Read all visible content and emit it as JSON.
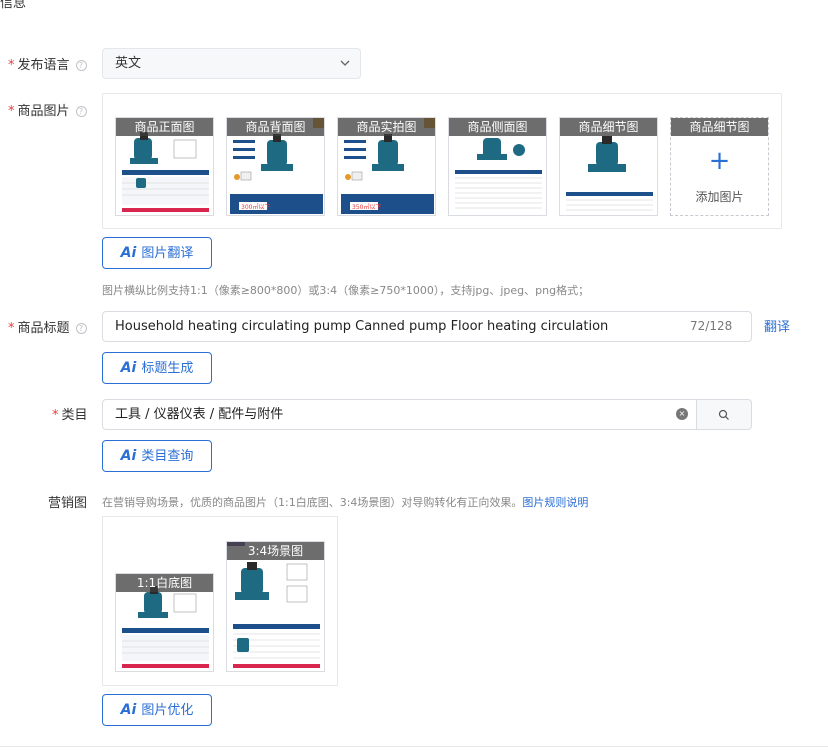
{
  "section_fragment": "信息",
  "language": {
    "label": "发布语言",
    "value": "英文"
  },
  "product_images": {
    "label": "商品图片",
    "thumbnails": [
      {
        "caption": "商品正面图"
      },
      {
        "caption": "商品背面图"
      },
      {
        "caption": "商品实拍图"
      },
      {
        "caption": "商品侧面图"
      },
      {
        "caption": "商品细节图"
      }
    ],
    "add_slot": {
      "caption": "商品细节图",
      "plus": "+",
      "text": "添加图片"
    },
    "translate_button": {
      "ai": "Ai",
      "label": "图片翻译"
    },
    "hint": "图片横纵比例支持1:1（像素≥800*800）或3:4（像素≥750*1000），支持jpg、jpeg、png格式；",
    "badge_text_1": "300㎡以下",
    "badge_text_2": "350㎡以下"
  },
  "title": {
    "label": "商品标题",
    "value": "Household heating circulating pump Canned pump Floor heating circulation",
    "counter": "72/128",
    "translate_link": "翻译",
    "generate_button": {
      "ai": "Ai",
      "label": "标题生成"
    }
  },
  "category": {
    "label": "类目",
    "value": "工具 / 仪器仪表 / 配件与附件",
    "clear_icon": "×",
    "search_icon": "search-icon",
    "query_button": {
      "ai": "Ai",
      "label": "类目查询"
    }
  },
  "marketing": {
    "label": "营销图",
    "hint": "在营销导购场景，优质的商品图片（1:1白底图、3:4场景图）对导购转化有正向效果。",
    "hint_link": "图片规则说明",
    "images": [
      {
        "caption": "1:1白底图"
      },
      {
        "caption": "3:4场景图"
      }
    ],
    "optimize_button": {
      "ai": "Ai",
      "label": "图片优化"
    }
  },
  "colors": {
    "accent": "#2b6fd6",
    "required": "#e8393a",
    "pump_teal": "#1e6a83",
    "banner_navy": "#1d4f8a"
  }
}
